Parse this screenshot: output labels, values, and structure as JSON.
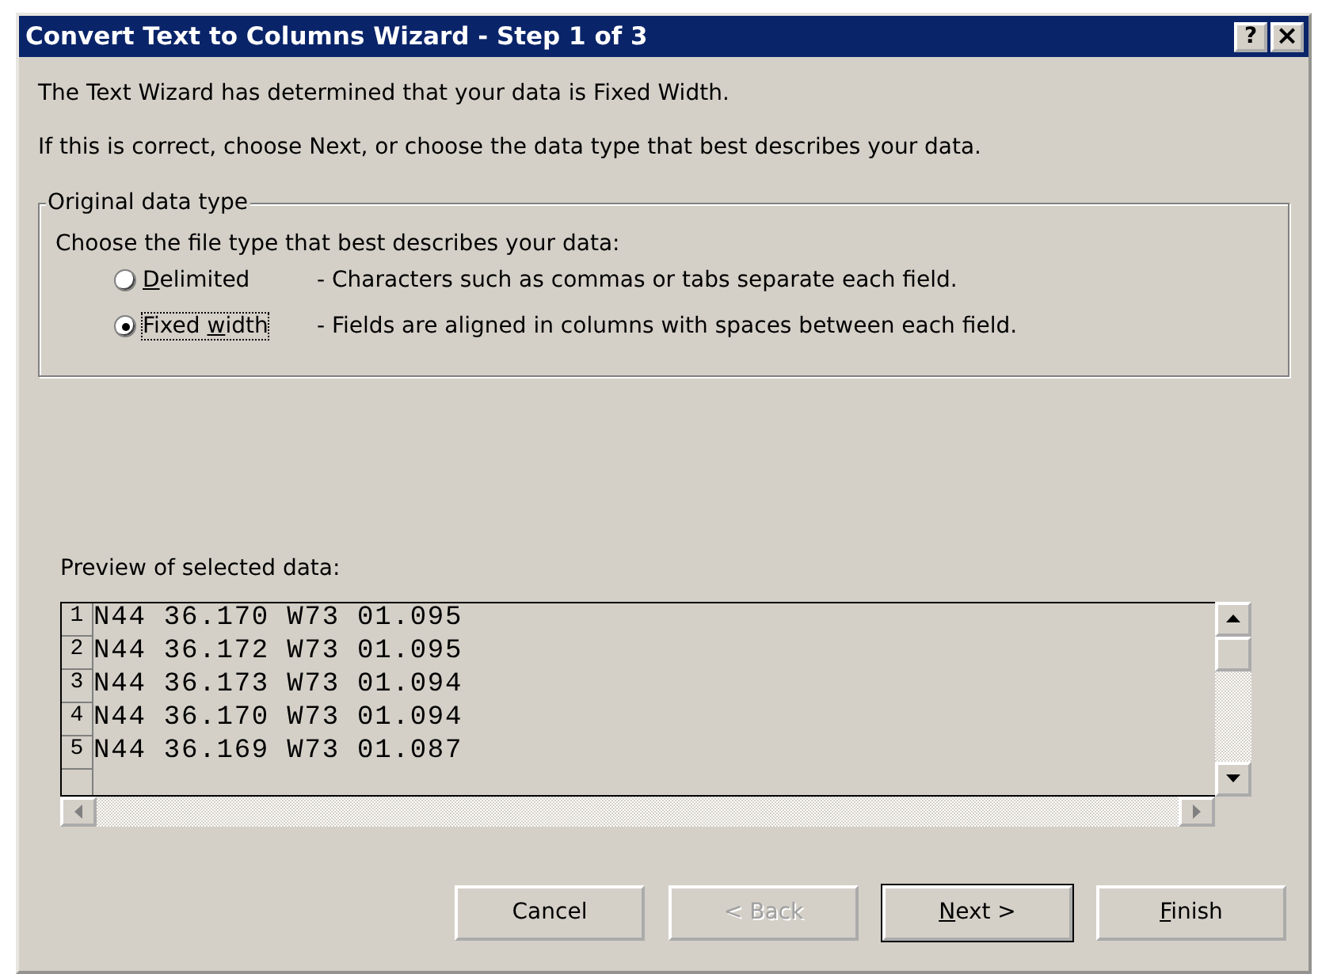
{
  "window": {
    "title": "Convert Text to Columns Wizard - Step 1 of 3",
    "controls": [
      {
        "kind": "help",
        "label": "?"
      },
      {
        "kind": "close",
        "label": "×"
      }
    ]
  },
  "intro": [
    "The Text Wizard has determined that your data is Fixed Width.",
    "If this is correct, choose Next, or choose the data type that best describes your data."
  ],
  "group": {
    "legend": "Original data type",
    "prompt": "Choose the file type that best describes your data:",
    "options": [
      {
        "access_key": "D",
        "label_after": "elimited",
        "selected": false,
        "focused": false,
        "description": "- Characters such as commas or tabs separate each field."
      },
      {
        "label_before": "Fixed ",
        "access_key": "w",
        "label_after": "idth",
        "selected": true,
        "focused": true,
        "description": "- Fields are aligned in columns with spaces between each field."
      }
    ]
  },
  "preview": {
    "label": "Preview of selected data:",
    "rows": [
      {
        "number": "1",
        "text": "N44 36.170 W73 01.095"
      },
      {
        "number": "2",
        "text": "N44 36.172 W73 01.095"
      },
      {
        "number": "3",
        "text": "N44 36.173 W73 01.094"
      },
      {
        "number": "4",
        "text": "N44 36.170 W73 01.094"
      },
      {
        "number": "5",
        "text": "N44 36.169 W73 01.087"
      }
    ]
  },
  "buttons": [
    {
      "label_after": "Cancel",
      "disabled": false,
      "default": false
    },
    {
      "label_after": "< Back",
      "disabled": true,
      "default": false
    },
    {
      "access_key": "N",
      "label_after": "ext >",
      "disabled": false,
      "default": true
    },
    {
      "access_key": "F",
      "label_after": "inish",
      "disabled": false,
      "default": false
    }
  ]
}
